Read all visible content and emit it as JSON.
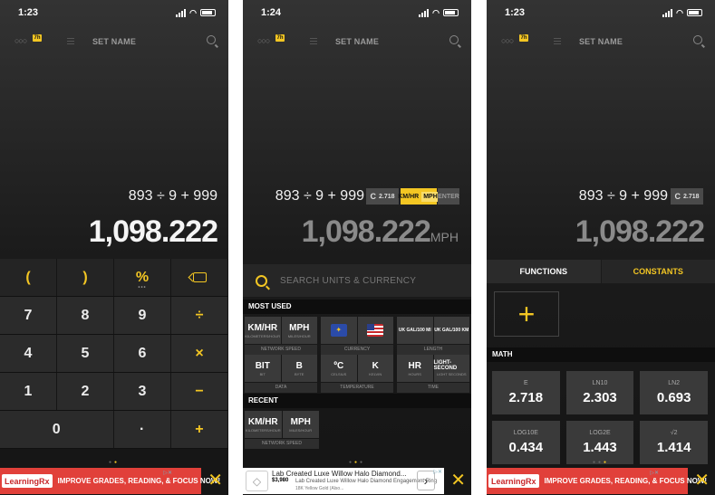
{
  "accent_color": "#f3c623",
  "panels": [
    {
      "time": "1:23",
      "title": "SET NAME",
      "dots": "○○○",
      "badge": "7h",
      "expression": "893 ÷ 9 + 999",
      "result": "1,098.222",
      "keypad": [
        [
          "(",
          ")",
          "%",
          "backspace-icon"
        ],
        [
          "7",
          "8",
          "9",
          "÷"
        ],
        [
          "4",
          "5",
          "6",
          "×"
        ],
        [
          "1",
          "2",
          "3",
          "−"
        ],
        [
          "0",
          "·",
          "+"
        ]
      ],
      "ad": {
        "logo": "LearningRx",
        "text": "IMPROVE GRADES, READING, & FOCUS NOW!",
        "close": "✕"
      }
    },
    {
      "time": "1:24",
      "title": "SET NAME",
      "dots": "○○○",
      "badge": "7h",
      "expression": "893 ÷ 9 + 999",
      "const_key": "C",
      "const_val": "2.718",
      "unit_from": "KM/HR",
      "unit_to": "MPH",
      "enter": "ENTER",
      "result": "1,098.222",
      "result_unit": "MPH",
      "search_placeholder": "SEARCH UNITS & CURRENCY",
      "most_used": "MOST USED",
      "recent": "RECENT",
      "cards": [
        {
          "a": "KM/HR",
          "a_sub": "KILOMETERS/HOUR",
          "b": "MPH",
          "b_sub": "MILES/HOUR",
          "label": "NETWORK SPEED"
        },
        {
          "a": "eu-flag",
          "b": "us-flag",
          "label": "CURRENCY"
        },
        {
          "a": "UK GAL/100 MI",
          "b": "UK GAL/100 KM",
          "label": "LENGTH"
        },
        {
          "a": "BIT",
          "a_sub": "BIT",
          "b": "B",
          "b_sub": "BYTE",
          "label": "DATA"
        },
        {
          "a": "ºC",
          "a_sub": "CELSIUS",
          "b": "K",
          "b_sub": "KELVIN",
          "label": "TEMPERATURE"
        },
        {
          "a": "HR",
          "a_sub": "HOURS",
          "b": "LIGHT-SECOND",
          "b_sub": "LIGHT SECONDS",
          "label": "TIME"
        }
      ],
      "recent_cards": [
        {
          "a": "KM/HR",
          "a_sub": "KILOMETERS/HOUR",
          "b": "MPH",
          "b_sub": "MILES/HOUR",
          "label": "NETWORK SPEED"
        }
      ],
      "ad": {
        "title": "Lab Created Luxe Willow Halo Diamond...",
        "price": "$3,980",
        "sub": "Lab Created Luxe Willow Halo Diamond Engagement Ring",
        "sub2": "18K Yellow Gold (Also...",
        "close": "✕"
      }
    },
    {
      "time": "1:23",
      "title": "SET NAME",
      "dots": "○○○",
      "badge": "7h",
      "expression": "893 ÷ 9 + 999",
      "const_key": "C",
      "const_val": "2.718",
      "result": "1,098.222",
      "tabs": [
        "FUNCTIONS",
        "CONSTANTS"
      ],
      "plus": "+",
      "math": "MATH",
      "constants": [
        {
          "name": "E",
          "value": "2.718"
        },
        {
          "name": "LN10",
          "value": "2.303"
        },
        {
          "name": "LN2",
          "value": "0.693"
        },
        {
          "name": "LOG10E",
          "value": "0.434"
        },
        {
          "name": "LOG2E",
          "value": "1.443"
        },
        {
          "name": "√2",
          "value": "1.414"
        }
      ],
      "ad": {
        "logo": "LearningRx",
        "text": "IMPROVE GRADES, READING, & FOCUS NOW!",
        "close": "✕"
      }
    }
  ]
}
